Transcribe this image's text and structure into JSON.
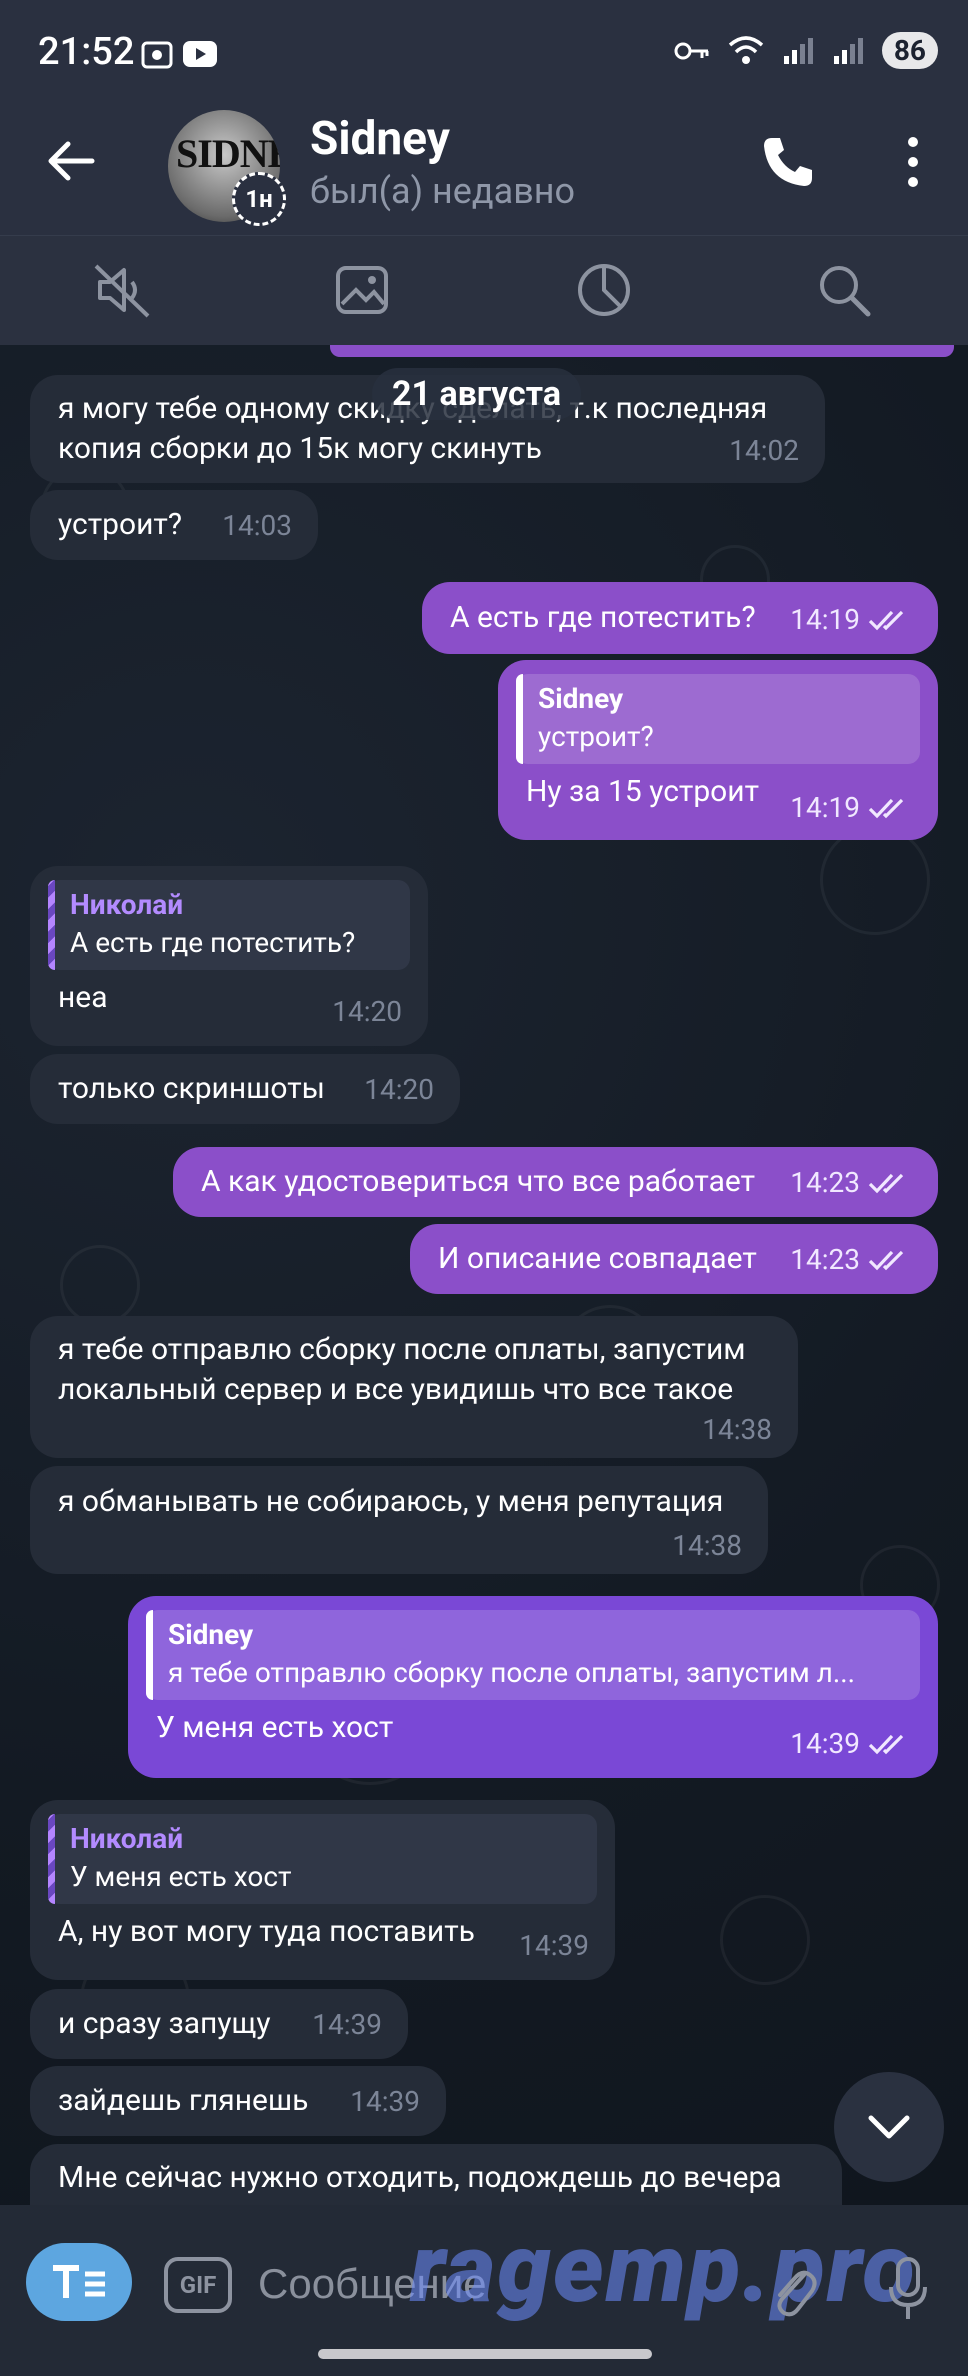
{
  "status_bar": {
    "time": "21:52",
    "battery": "86"
  },
  "header": {
    "contact_name": "Sidney",
    "contact_status": "был(а) недавно",
    "story_badge": "1н",
    "avatar_text": "SIDNEY"
  },
  "date_pill": "21 августа",
  "messages": [
    {
      "dir": "in",
      "text": "я могу тебе одному скидку сделать, т.к последняя копия сборки до 15к могу скинуть",
      "time": "14:02"
    },
    {
      "dir": "in",
      "text": "устроит?",
      "time": "14:03"
    },
    {
      "dir": "out",
      "text": "А есть где потестить?",
      "time": "14:19"
    },
    {
      "dir": "out",
      "reply_name": "Sidney",
      "reply_text": "устроит?",
      "text": "Ну за 15 устроит",
      "time": "14:19"
    },
    {
      "dir": "in",
      "reply_name": "Николай",
      "reply_text": "А есть где потестить?",
      "text": "неа",
      "time": "14:20"
    },
    {
      "dir": "in",
      "text": "только скриншоты",
      "time": "14:20"
    },
    {
      "dir": "out",
      "text": "А как удостовериться что все работает",
      "time": "14:23"
    },
    {
      "dir": "out",
      "text": "И описание совпадает",
      "time": "14:23"
    },
    {
      "dir": "in",
      "text": "я тебе отправлю сборку после оплаты, запустим локальный сервер и все увидишь что все такое",
      "time": "14:38"
    },
    {
      "dir": "in",
      "text": "я обманывать не собираюсь, у меня репутация",
      "time": "14:38"
    },
    {
      "dir": "out",
      "reply_name": "Sidney",
      "reply_text": "я тебе отправлю сборку после оплаты, запустим л...",
      "text": "У меня есть хост",
      "time": "14:39"
    },
    {
      "dir": "in",
      "reply_name": "Николай",
      "reply_text": "У меня есть хост",
      "text": "А, ну вот могу туда поставить",
      "time": "14:39"
    },
    {
      "dir": "in",
      "text": "и сразу запущу",
      "time": "14:39"
    },
    {
      "dir": "in",
      "text": "зайдешь глянешь",
      "time": "14:39"
    },
    {
      "dir": "in",
      "text": "Мне сейчас нужно отходить, подождешь до вечера",
      "time": ""
    }
  ],
  "input": {
    "placeholder": "Сообщение",
    "gif_label": "GIF",
    "watermark": "ragemp.pro"
  }
}
